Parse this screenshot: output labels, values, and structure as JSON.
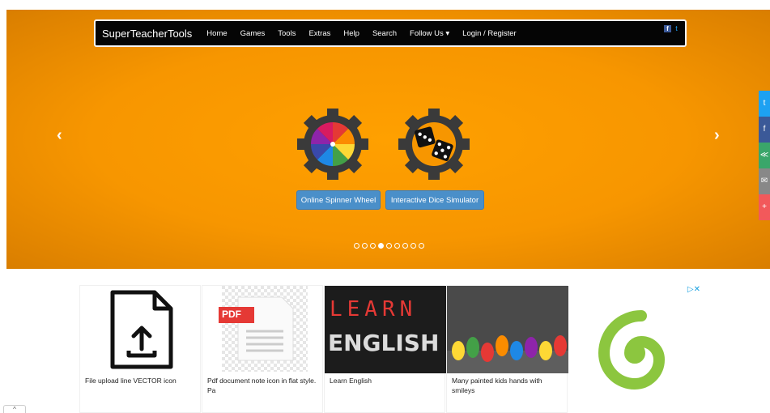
{
  "navbar": {
    "brand": "SuperTeacherTools",
    "items": [
      "Home",
      "Games",
      "Tools",
      "Extras",
      "Help",
      "Search",
      "Follow Us ▾",
      "Login / Register"
    ],
    "social": [
      "facebook-icon",
      "twitter-icon"
    ]
  },
  "carousel": {
    "prev_icon": "‹",
    "next_icon": "›",
    "buttons": [
      "Online Spinner Wheel",
      "Interactive Dice Simulator"
    ],
    "indicator_count": 9,
    "active_indicator": 3
  },
  "share_bar": [
    {
      "icon": "twitter-icon",
      "glyph": "t",
      "color": "#1da1f2"
    },
    {
      "icon": "facebook-icon",
      "glyph": "f",
      "color": "#3b5998"
    },
    {
      "icon": "share-icon",
      "glyph": "≪",
      "color": "#3aa66a"
    },
    {
      "icon": "mail-icon",
      "glyph": "✉",
      "color": "#888888"
    },
    {
      "icon": "plus-icon",
      "glyph": "+",
      "color": "#f2595b"
    }
  ],
  "ads": [
    {
      "caption": "File upload line VECTOR icon"
    },
    {
      "caption": "Pdf document note icon in flat style. Pa",
      "badge": "PDF"
    },
    {
      "caption": "Learn English",
      "top_word": "LEARN",
      "bottom_word": "ENGLISH"
    },
    {
      "caption": "Many painted kids hands with smileys"
    }
  ],
  "adchoices": "▷✕",
  "scroll_top": "^",
  "colors": {
    "hero_orange": "#f79600",
    "button_blue": "#4a8fc9",
    "navbar_black": "#050505",
    "spiral_green": "#8cc63f"
  }
}
